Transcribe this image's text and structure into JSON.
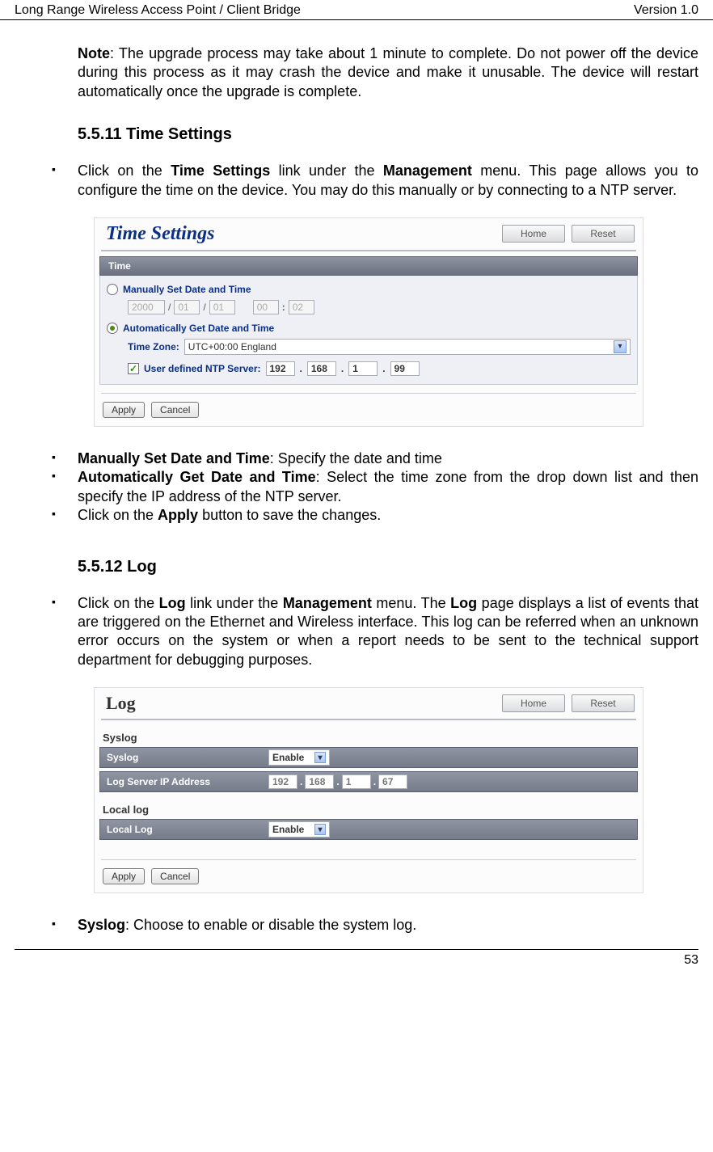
{
  "header": {
    "left": "Long Range Wireless Access Point / Client Bridge",
    "right": "Version 1.0"
  },
  "footer": {
    "page": "53"
  },
  "note_bold": "Note",
  "note_text": ": The upgrade process may take about 1 minute to complete. Do not power off the device during this process as it may crash the device and make it unusable. The device will restart automatically once the upgrade is complete.",
  "s1_heading": "5.5.11 Time Settings",
  "s1_b1_pre": "Click on the ",
  "s1_b1_bold1": "Time Settings",
  "s1_b1_mid": " link under the ",
  "s1_b1_bold2": "Management",
  "s1_b1_post": " menu. This page allows you to configure the time on the device. You may do this manually or by connecting to a NTP server.",
  "time_panel": {
    "title": "Time Settings",
    "btn_home": "Home",
    "btn_reset": "Reset",
    "section": "Time",
    "manual_label": "Manually Set Date and Time",
    "date_year": "2000",
    "date_m": "01",
    "date_d": "01",
    "date_h": "00",
    "date_min": "02",
    "auto_label": "Automatically Get Date and Time",
    "tz_label": "Time Zone:",
    "tz_value": "UTC+00:00 England",
    "ntp_label": "User defined NTP Server:",
    "ntp1": "192",
    "ntp2": "168",
    "ntp3": "1",
    "ntp4": "99",
    "apply": "Apply",
    "cancel": "Cancel"
  },
  "s1_b2_bold": "Manually Set Date and Time",
  "s1_b2_text": ": Specify the date and time",
  "s1_b3_bold": "Automatically Get Date and Time",
  "s1_b3_text": ": Select the time zone from the drop down list and then specify the IP address of the NTP server.",
  "s1_b4_pre": "Click on the ",
  "s1_b4_bold": "Apply",
  "s1_b4_post": " button to save the changes.",
  "s2_heading": "5.5.12 Log",
  "s2_b1_pre": "Click on the ",
  "s2_b1_bold1": "Log",
  "s2_b1_mid1": " link under the ",
  "s2_b1_bold2": "Management",
  "s2_b1_mid2": " menu. The ",
  "s2_b1_bold3": "Log",
  "s2_b1_post": " page displays a list of events that are triggered on the Ethernet and Wireless interface. This log can be referred when an unknown error occurs on the system or when a report needs to be sent to the technical support department for debugging purposes.",
  "log_panel": {
    "title": "Log",
    "btn_home": "Home",
    "btn_reset": "Reset",
    "sec_syslog": "Syslog",
    "row_syslog": "Syslog",
    "row_syslog_val": "Enable",
    "row_ip": "Log Server IP Address",
    "ip1": "192",
    "ip2": "168",
    "ip3": "1",
    "ip4": "67",
    "sec_local": "Local log",
    "row_local": "Local Log",
    "row_local_val": "Enable",
    "apply": "Apply",
    "cancel": "Cancel"
  },
  "s2_b2_bold": "Syslog",
  "s2_b2_text": ": Choose to enable or disable the system log."
}
